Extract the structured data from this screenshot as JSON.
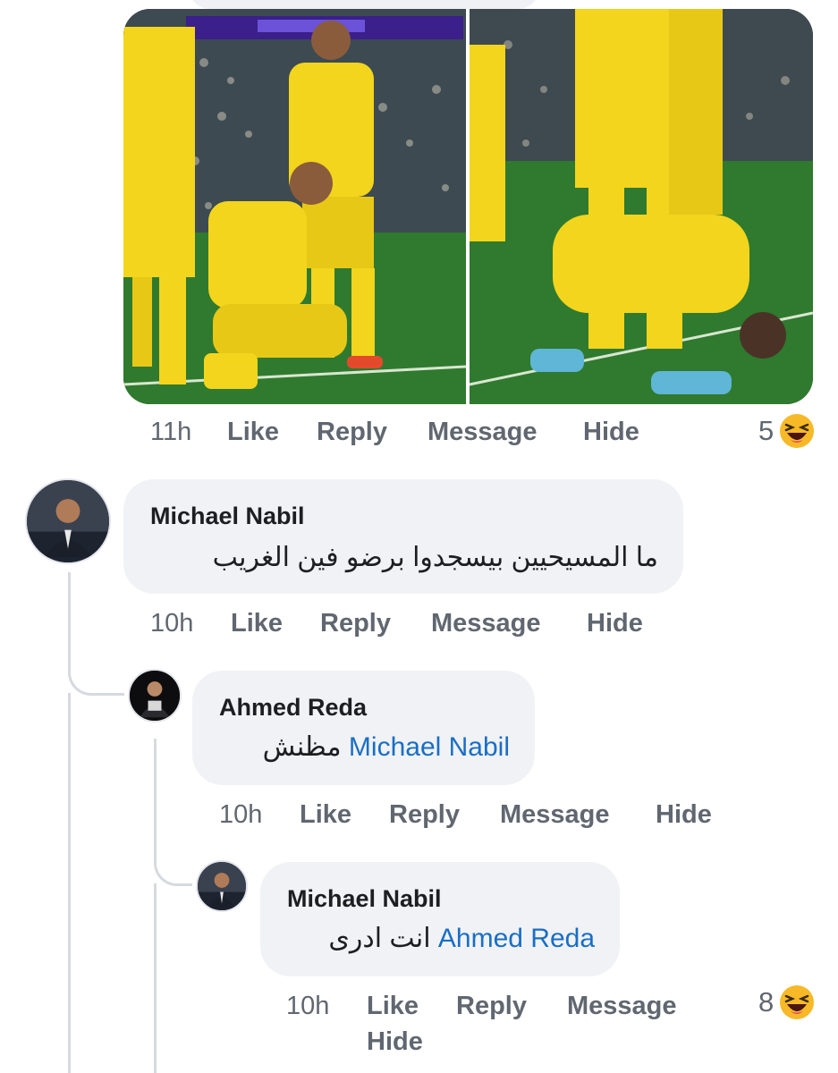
{
  "post": {
    "photo_alt": "",
    "actions": {
      "time": "11h",
      "like": "Like",
      "reply": "Reply",
      "message": "Message",
      "hide": "Hide"
    },
    "reaction": {
      "count": "5",
      "icon": "laughing-face-icon"
    }
  },
  "comments": [
    {
      "author": "Michael Nabil",
      "text": "ما المسيحيين بيسجدوا برضو فين الغريب",
      "mention": "",
      "actions": {
        "time": "10h",
        "like": "Like",
        "reply": "Reply",
        "message": "Message",
        "hide": "Hide"
      }
    },
    {
      "author": "Ahmed Reda",
      "text": "مظنش",
      "mention": "Michael Nabil",
      "actions": {
        "time": "10h",
        "like": "Like",
        "reply": "Reply",
        "message": "Message",
        "hide": "Hide"
      }
    },
    {
      "author": "Michael Nabil",
      "text": "انت ادرى",
      "mention": "Ahmed Reda",
      "actions": {
        "time": "10h",
        "like": "Like",
        "reply": "Reply",
        "message": "Message",
        "hide": "Hide"
      },
      "reaction": {
        "count": "8",
        "icon": "laughing-face-icon"
      }
    }
  ],
  "colors": {
    "bubble": "#f0f2f5",
    "mention": "#1a6ec4",
    "jersey": "#f2d51c",
    "pitch": "#2f7a2e"
  }
}
